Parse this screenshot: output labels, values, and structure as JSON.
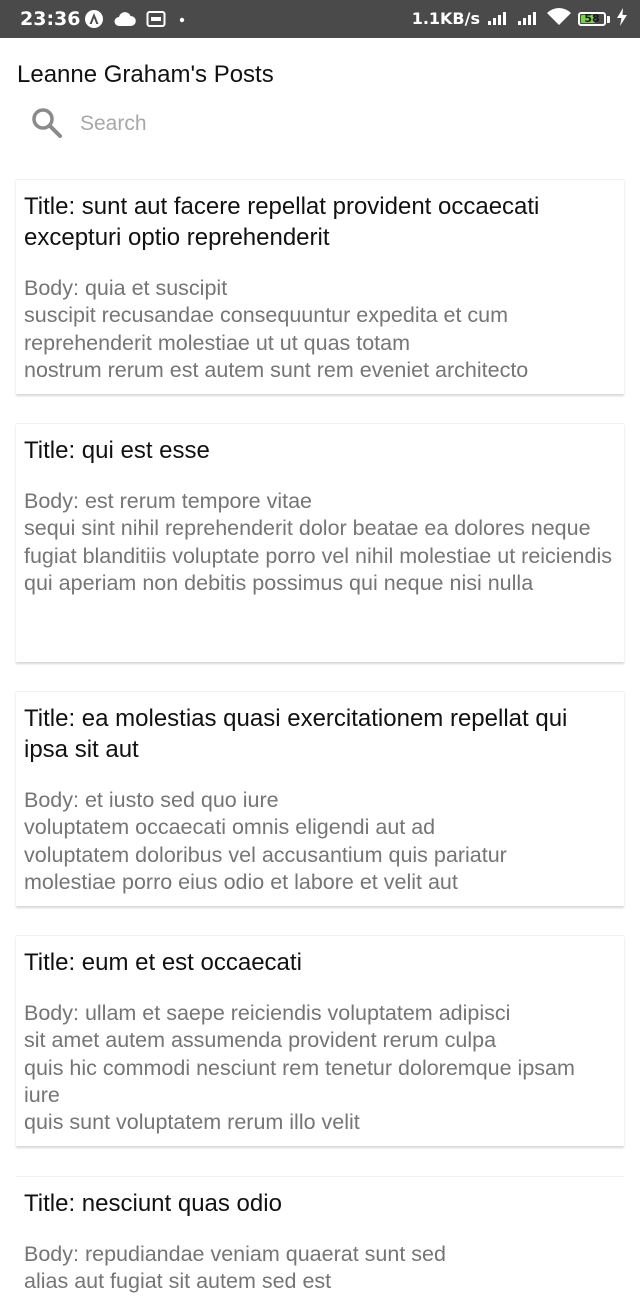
{
  "status_bar": {
    "time": "23:36",
    "network_speed": "1.1KB/s",
    "battery_level": "58",
    "battery_color": "#7cd14b",
    "icons": [
      "app-a-icon",
      "cloud-icon",
      "cast-icon",
      "dot-icon",
      "signal-icon",
      "signal-icon",
      "wifi-icon",
      "battery-icon",
      "charging-icon"
    ]
  },
  "header": {
    "title": "Leanne Graham's Posts"
  },
  "search": {
    "placeholder": "Search",
    "value": ""
  },
  "posts": [
    {
      "title": "Title: sunt aut facere repellat provident occaecati excepturi optio reprehenderit",
      "body": "Body: quia et suscipit\nsuscipit recusandae consequuntur expedita et cum\nreprehenderit molestiae ut ut quas totam\nnostrum rerum est autem sunt rem eveniet architecto"
    },
    {
      "title": "Title: qui est esse",
      "body": "Body: est rerum tempore vitae\nsequi sint nihil reprehenderit dolor beatae ea dolores neque\nfugiat blanditiis voluptate porro vel nihil molestiae ut reiciendis\nqui aperiam non debitis possimus qui neque nisi nulla"
    },
    {
      "title": "Title: ea molestias quasi exercitationem repellat qui ipsa sit aut",
      "body": "Body: et iusto sed quo iure\nvoluptatem occaecati omnis eligendi aut ad\nvoluptatem doloribus vel accusantium quis pariatur\nmolestiae porro eius odio et labore et velit aut"
    },
    {
      "title": "Title: eum et est occaecati",
      "body": "Body: ullam et saepe reiciendis voluptatem adipisci\nsit amet autem assumenda provident rerum culpa\nquis hic commodi nesciunt rem tenetur doloremque ipsam iure\nquis sunt voluptatem rerum illo velit"
    },
    {
      "title": "Title: nesciunt quas odio",
      "body": "Body: repudiandae veniam quaerat sunt sed\nalias aut fugiat sit autem sed est"
    }
  ]
}
